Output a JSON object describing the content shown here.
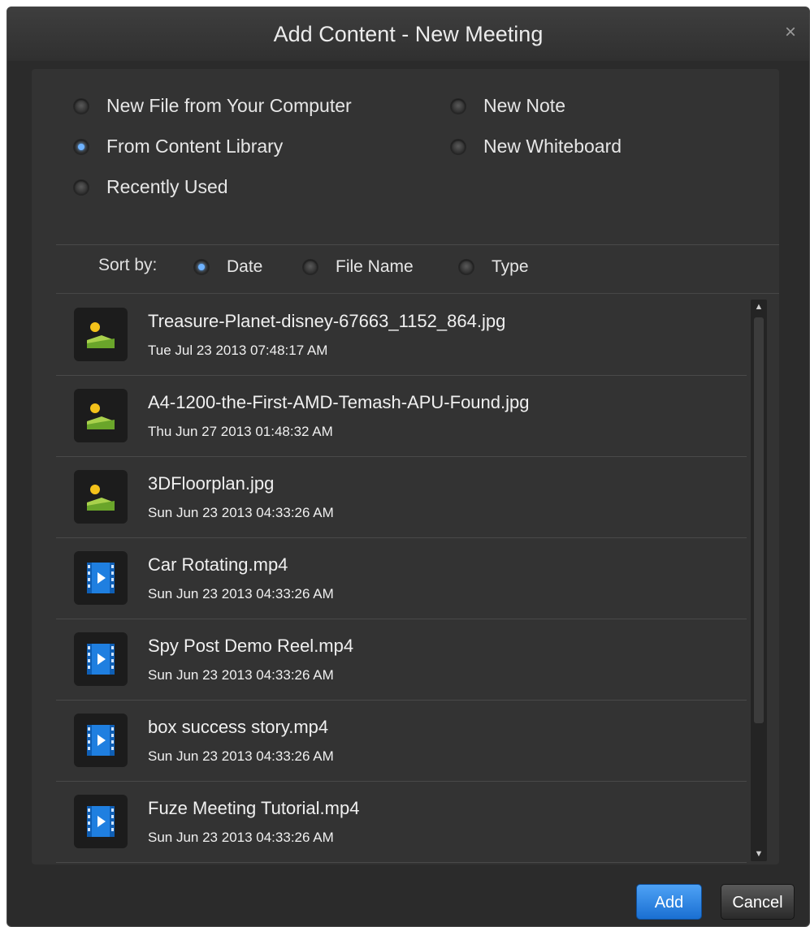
{
  "dialog": {
    "title": "Add Content - New Meeting",
    "close_glyph": "×"
  },
  "source_options": [
    {
      "label": "New File from Your Computer",
      "selected": false
    },
    {
      "label": "From Content Library",
      "selected": true
    },
    {
      "label": "Recently Used",
      "selected": false
    },
    {
      "label": "New Note",
      "selected": false
    },
    {
      "label": "New Whiteboard",
      "selected": false
    }
  ],
  "sort": {
    "label": "Sort by:",
    "options": [
      {
        "label": "Date",
        "selected": true
      },
      {
        "label": "File Name",
        "selected": false
      },
      {
        "label": "Type",
        "selected": false
      }
    ]
  },
  "files": [
    {
      "name": "Treasure-Planet-disney-67663_1152_864.jpg",
      "date": "Tue Jul 23 2013 07:48:17 AM",
      "type": "image",
      "icon": "image-file-icon"
    },
    {
      "name": "A4-1200-the-First-AMD-Temash-APU-Found.jpg",
      "date": "Thu Jun 27 2013 01:48:32 AM",
      "type": "image",
      "icon": "image-file-icon"
    },
    {
      "name": "3DFloorplan.jpg",
      "date": "Sun Jun 23 2013 04:33:26 AM",
      "type": "image",
      "icon": "image-file-icon"
    },
    {
      "name": "Car Rotating.mp4",
      "date": "Sun Jun 23 2013 04:33:26 AM",
      "type": "video",
      "icon": "video-file-icon"
    },
    {
      "name": "Spy Post Demo Reel.mp4",
      "date": "Sun Jun 23 2013 04:33:26 AM",
      "type": "video",
      "icon": "video-file-icon"
    },
    {
      "name": "box success story.mp4",
      "date": "Sun Jun 23 2013 04:33:26 AM",
      "type": "video",
      "icon": "video-file-icon"
    },
    {
      "name": "Fuze Meeting Tutorial.mp4",
      "date": "Sun Jun 23 2013 04:33:26 AM",
      "type": "video",
      "icon": "video-file-icon"
    }
  ],
  "buttons": {
    "add": "Add",
    "cancel": "Cancel"
  },
  "colors": {
    "accent": "#1a6fd2",
    "background": "#2b2b2b",
    "panel": "#333333"
  }
}
